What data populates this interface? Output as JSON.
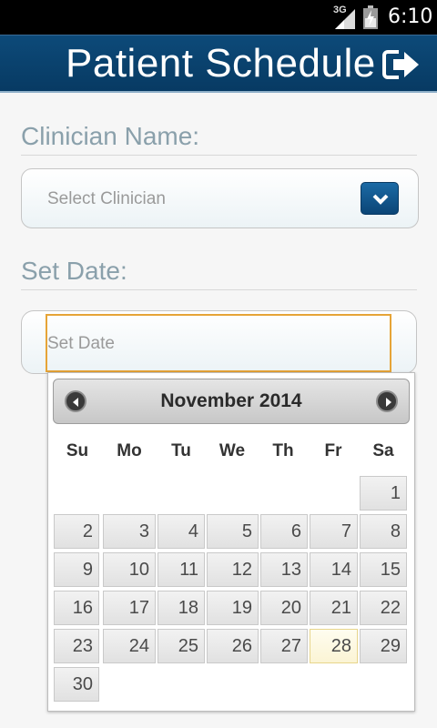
{
  "status_bar": {
    "network": "3G",
    "time": "6:10"
  },
  "app_bar": {
    "title": "Patient Schedule",
    "logout_icon": "logout-icon"
  },
  "clinician": {
    "label": "Clinician Name:",
    "placeholder": "Select Clinician"
  },
  "date": {
    "label": "Set Date:",
    "placeholder": "Set Date"
  },
  "calendar": {
    "month_label": "November 2014",
    "weekdays": [
      "Su",
      "Mo",
      "Tu",
      "We",
      "Th",
      "Fr",
      "Sa"
    ],
    "days": [
      "1",
      "2",
      "3",
      "4",
      "5",
      "6",
      "7",
      "8",
      "9",
      "10",
      "11",
      "12",
      "13",
      "14",
      "15",
      "16",
      "17",
      "18",
      "19",
      "20",
      "21",
      "22",
      "23",
      "24",
      "25",
      "26",
      "27",
      "28",
      "29",
      "30"
    ],
    "first_weekday_index": 6,
    "highlighted_day": "28"
  },
  "colors": {
    "app_bar": "#0d4a79",
    "input_focus": "#e6a437",
    "today_highlight": "#fbf4d4"
  }
}
